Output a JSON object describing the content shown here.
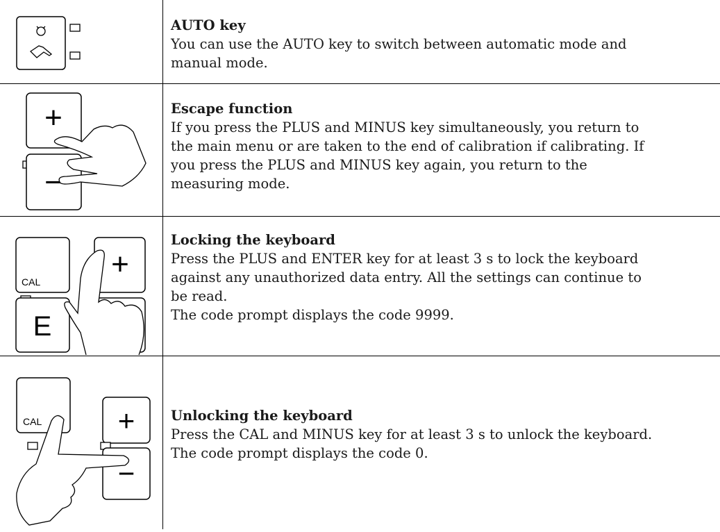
{
  "rows": [
    {
      "title": "AUTO key",
      "body": "You can use the AUTO key to switch between automatic mode and\nmanual mode."
    },
    {
      "title": "Escape function",
      "body": "If you press the PLUS and MINUS key simultaneously, you return to\nthe main menu or are taken to the end of calibration if calibrating. If\nyou press the PLUS and MINUS key again, you return to the\nmeasuring mode."
    },
    {
      "title": "Locking the keyboard",
      "body": "Press the PLUS and ENTER key for at least 3 s to lock the keyboard\nagainst any unauthorized data entry. All the settings can continue to\nbe read.\nThe code prompt displays the code 9999."
    },
    {
      "title": "Unlocking the keyboard",
      "body": "Press the CAL and MINUS key for at least 3 s to unlock the keyboard.\nThe code prompt displays the code 0."
    }
  ],
  "keys": {
    "plus": "+",
    "minus": "−",
    "cal": "CAL",
    "enter": "E"
  }
}
